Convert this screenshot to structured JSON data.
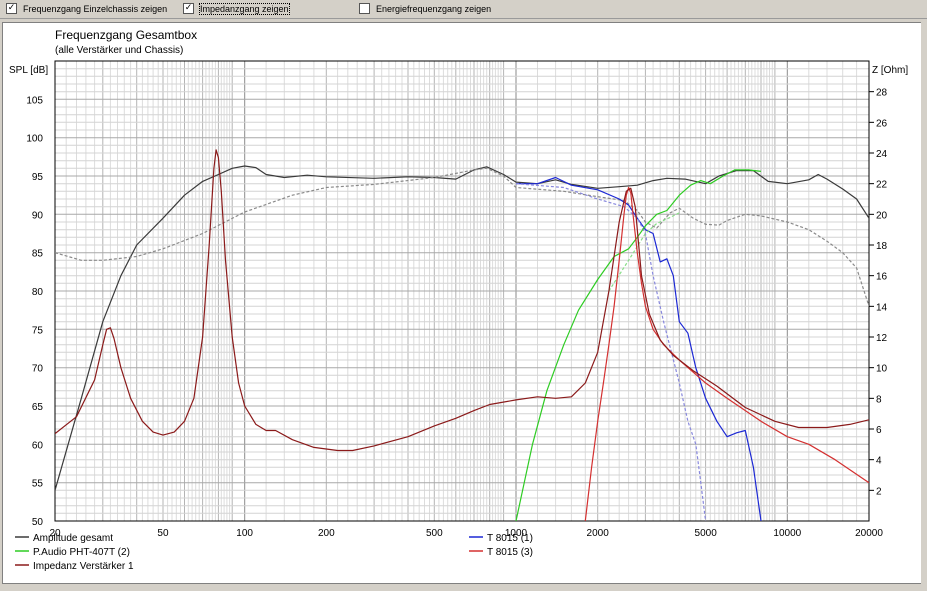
{
  "toolbar": {
    "options": [
      {
        "label": "Frequenzgang Einzelchassis zeigen",
        "checked": true,
        "check_glyph": "✓"
      },
      {
        "label": "Impedanzgang zeigen",
        "checked": true,
        "check_glyph": "✓"
      },
      {
        "label": "Energiefrequenzgang zeigen",
        "checked": false,
        "check_glyph": ""
      }
    ]
  },
  "chart_data": {
    "type": "line",
    "title": "Frequenzgang Gesamtbox",
    "subtitle": "(alle Verstärker und Chassis)",
    "xlabel": "",
    "ylabel": "SPL [dB]",
    "y2label": "Z [Ohm]",
    "xscale": "log",
    "xlim": [
      20,
      20000
    ],
    "ylim": [
      50,
      110
    ],
    "y2lim": [
      0,
      30
    ],
    "grid": true,
    "legend_position": "bottom",
    "x_ticks": [
      {
        "value": 20,
        "label": "20"
      },
      {
        "value": 50,
        "label": "50"
      },
      {
        "value": 100,
        "label": "100"
      },
      {
        "value": 200,
        "label": "200"
      },
      {
        "value": 500,
        "label": "500"
      },
      {
        "value": 1000,
        "label": "1000"
      },
      {
        "value": 2000,
        "label": "2000"
      },
      {
        "value": 5000,
        "label": "5000"
      },
      {
        "value": 10000,
        "label": "10000"
      },
      {
        "value": 20000,
        "label": "20000"
      }
    ],
    "y_ticks": [
      50,
      55,
      60,
      65,
      70,
      75,
      80,
      85,
      90,
      95,
      100,
      105
    ],
    "y2_ticks": [
      2,
      4,
      6,
      8,
      10,
      12,
      14,
      16,
      18,
      20,
      22,
      24,
      26,
      28
    ],
    "series": [
      {
        "name": "Amplitude gesamt",
        "color": "#3a3a3a",
        "axis": "left",
        "dash": false,
        "points": [
          [
            20,
            54
          ],
          [
            25,
            66
          ],
          [
            30,
            76
          ],
          [
            35,
            82
          ],
          [
            40,
            86
          ],
          [
            50,
            89.5
          ],
          [
            60,
            92.5
          ],
          [
            70,
            94.3
          ],
          [
            80,
            95.2
          ],
          [
            90,
            96
          ],
          [
            100,
            96.3
          ],
          [
            110,
            96.1
          ],
          [
            120,
            95.2
          ],
          [
            140,
            94.8
          ],
          [
            170,
            95.1
          ],
          [
            200,
            94.9
          ],
          [
            300,
            94.7
          ],
          [
            400,
            94.9
          ],
          [
            500,
            94.8
          ],
          [
            600,
            94.6
          ],
          [
            700,
            95.8
          ],
          [
            780,
            96.2
          ],
          [
            900,
            95.2
          ],
          [
            1000,
            94.2
          ],
          [
            1200,
            94
          ],
          [
            1400,
            94.5
          ],
          [
            1600,
            93.9
          ],
          [
            2000,
            93.4
          ],
          [
            2400,
            93.6
          ],
          [
            2800,
            93.8
          ],
          [
            3200,
            94.4
          ],
          [
            3600,
            94.7
          ],
          [
            4200,
            94.6
          ],
          [
            5000,
            94
          ],
          [
            5600,
            95
          ],
          [
            6500,
            95.7
          ],
          [
            7500,
            95.7
          ],
          [
            8500,
            94.3
          ],
          [
            10000,
            94
          ],
          [
            12000,
            94.5
          ],
          [
            13000,
            95.2
          ],
          [
            14000,
            94.6
          ],
          [
            16000,
            93.3
          ],
          [
            18000,
            92
          ],
          [
            20000,
            89.5
          ]
        ]
      },
      {
        "name": "Amplitude gesamt (gestrichelt)",
        "color": "#8a8a8a",
        "axis": "left",
        "dash": true,
        "points": [
          [
            20,
            85
          ],
          [
            25,
            84
          ],
          [
            30,
            84
          ],
          [
            40,
            84.5
          ],
          [
            50,
            85.5
          ],
          [
            70,
            87.5
          ],
          [
            100,
            90.3
          ],
          [
            150,
            92.5
          ],
          [
            200,
            93.5
          ],
          [
            300,
            93.9
          ],
          [
            500,
            94.8
          ],
          [
            700,
            95.8
          ],
          [
            780,
            96
          ],
          [
            900,
            95
          ],
          [
            1000,
            93.5
          ],
          [
            1500,
            93
          ],
          [
            2000,
            92.3
          ],
          [
            2500,
            91.8
          ],
          [
            2800,
            90.5
          ],
          [
            3000,
            89
          ],
          [
            3300,
            88.2
          ],
          [
            3700,
            90.2
          ],
          [
            4000,
            90.8
          ],
          [
            4500,
            89.5
          ],
          [
            5000,
            88.7
          ],
          [
            5600,
            88.6
          ],
          [
            6000,
            89.2
          ],
          [
            7000,
            90
          ],
          [
            8000,
            89.8
          ],
          [
            10000,
            89
          ],
          [
            12000,
            88
          ],
          [
            14000,
            86.5
          ],
          [
            16000,
            85
          ],
          [
            18000,
            83
          ],
          [
            20000,
            78
          ]
        ]
      },
      {
        "name": "T 8015 (1)",
        "color": "#1c28d4",
        "axis": "left",
        "dash": false,
        "points": [
          [
            1000,
            94
          ],
          [
            1200,
            94
          ],
          [
            1400,
            94.8
          ],
          [
            1600,
            93.8
          ],
          [
            2000,
            93.2
          ],
          [
            2400,
            92
          ],
          [
            2600,
            91.2
          ],
          [
            2800,
            89.5
          ],
          [
            3000,
            88
          ],
          [
            3200,
            87.5
          ],
          [
            3400,
            83.8
          ],
          [
            3600,
            84.2
          ],
          [
            3800,
            82
          ],
          [
            4000,
            76
          ],
          [
            4300,
            74.5
          ],
          [
            4600,
            70
          ],
          [
            5000,
            66
          ],
          [
            5500,
            63
          ],
          [
            6000,
            61
          ],
          [
            6500,
            61.5
          ],
          [
            7000,
            61.8
          ],
          [
            7500,
            57
          ],
          [
            8000,
            50
          ]
        ]
      },
      {
        "name": "T 8015 (1) (gestrichelt)",
        "color": "#8888dd",
        "axis": "left",
        "dash": true,
        "points": [
          [
            1000,
            94
          ],
          [
            1500,
            93.5
          ],
          [
            2000,
            92
          ],
          [
            2500,
            91
          ],
          [
            2800,
            89.5
          ],
          [
            3000,
            87.5
          ],
          [
            3200,
            82
          ],
          [
            3500,
            76
          ],
          [
            4000,
            68
          ],
          [
            4300,
            63
          ],
          [
            4600,
            60
          ],
          [
            4800,
            55
          ],
          [
            5000,
            50
          ]
        ]
      },
      {
        "name": "P.Audio PHT-407T (2)",
        "color": "#2ecc23",
        "axis": "left",
        "dash": false,
        "points": [
          [
            1000,
            50
          ],
          [
            1150,
            60
          ],
          [
            1300,
            67
          ],
          [
            1500,
            73
          ],
          [
            1700,
            77.5
          ],
          [
            2000,
            81.5
          ],
          [
            2300,
            84.5
          ],
          [
            2600,
            85.5
          ],
          [
            2800,
            87
          ],
          [
            3000,
            88.5
          ],
          [
            3300,
            90
          ],
          [
            3600,
            90.5
          ],
          [
            4000,
            92.5
          ],
          [
            4400,
            93.8
          ],
          [
            4800,
            94.4
          ],
          [
            5200,
            94
          ],
          [
            5800,
            95
          ],
          [
            6400,
            95.8
          ],
          [
            7200,
            95.8
          ],
          [
            8000,
            95.6
          ]
        ]
      },
      {
        "name": "P.Audio PHT-407T (2) (gestrichelt)",
        "color": "#88dd88",
        "axis": "left",
        "dash": true,
        "points": [
          [
            2200,
            80
          ],
          [
            2600,
            84
          ],
          [
            3000,
            87.5
          ],
          [
            3300,
            88.8
          ],
          [
            3700,
            89.6
          ],
          [
            4000,
            90.2
          ]
        ]
      },
      {
        "name": "T 8015 (3)",
        "color": "#d43030",
        "axis": "left",
        "dash": false,
        "points": [
          [
            1800,
            50
          ],
          [
            1900,
            57
          ],
          [
            2000,
            63
          ],
          [
            2100,
            68
          ],
          [
            2200,
            73
          ],
          [
            2300,
            78
          ],
          [
            2400,
            84
          ],
          [
            2500,
            90
          ],
          [
            2550,
            92.5
          ],
          [
            2600,
            93.5
          ],
          [
            2650,
            92.8
          ],
          [
            2700,
            90
          ],
          [
            2800,
            85
          ],
          [
            2900,
            81
          ],
          [
            3000,
            78
          ],
          [
            3200,
            75
          ],
          [
            3500,
            73
          ],
          [
            4000,
            71
          ],
          [
            5000,
            68
          ],
          [
            6000,
            66
          ],
          [
            8000,
            63
          ],
          [
            10000,
            61
          ],
          [
            12000,
            60
          ],
          [
            15000,
            58
          ],
          [
            20000,
            55
          ]
        ]
      },
      {
        "name": "Impedanz Verstärker 1",
        "color": "#8b1a1a",
        "axis": "right",
        "dash": false,
        "points": [
          [
            20,
            5.7
          ],
          [
            24,
            6.8
          ],
          [
            28,
            9.2
          ],
          [
            30,
            11.5
          ],
          [
            31,
            12.5
          ],
          [
            32,
            12.6
          ],
          [
            33,
            11.9
          ],
          [
            35,
            10
          ],
          [
            38,
            8
          ],
          [
            42,
            6.5
          ],
          [
            46,
            5.8
          ],
          [
            50,
            5.6
          ],
          [
            55,
            5.8
          ],
          [
            60,
            6.5
          ],
          [
            65,
            8
          ],
          [
            70,
            12
          ],
          [
            74,
            18
          ],
          [
            77,
            23
          ],
          [
            78.5,
            24.2
          ],
          [
            80,
            23.7
          ],
          [
            82,
            21.5
          ],
          [
            85,
            17
          ],
          [
            90,
            12
          ],
          [
            95,
            9
          ],
          [
            100,
            7.5
          ],
          [
            110,
            6.3
          ],
          [
            120,
            5.9
          ],
          [
            130,
            5.9
          ],
          [
            150,
            5.3
          ],
          [
            180,
            4.8
          ],
          [
            220,
            4.6
          ],
          [
            250,
            4.6
          ],
          [
            300,
            4.9
          ],
          [
            400,
            5.5
          ],
          [
            500,
            6.2
          ],
          [
            600,
            6.7
          ],
          [
            700,
            7.2
          ],
          [
            800,
            7.6
          ],
          [
            1000,
            7.9
          ],
          [
            1200,
            8.1
          ],
          [
            1400,
            8
          ],
          [
            1600,
            8.1
          ],
          [
            1800,
            9
          ],
          [
            2000,
            11
          ],
          [
            2200,
            15
          ],
          [
            2400,
            19.5
          ],
          [
            2550,
            21.5
          ],
          [
            2650,
            21.7
          ],
          [
            2750,
            20.5
          ],
          [
            2900,
            16
          ],
          [
            3100,
            13.5
          ],
          [
            3400,
            11.8
          ],
          [
            3800,
            10.8
          ],
          [
            4500,
            9.8
          ],
          [
            5500,
            8.8
          ],
          [
            7000,
            7.4
          ],
          [
            9000,
            6.5
          ],
          [
            11000,
            6.1
          ],
          [
            14000,
            6.1
          ],
          [
            17000,
            6.3
          ],
          [
            20000,
            6.6
          ]
        ]
      }
    ],
    "legend": [
      {
        "label": "Amplitude gesamt",
        "color": "#3a3a3a"
      },
      {
        "label": "T 8015 (1)",
        "color": "#1c28d4"
      },
      {
        "label": "P.Audio PHT-407T (2)",
        "color": "#2ecc23"
      },
      {
        "label": "T 8015 (3)",
        "color": "#d43030"
      },
      {
        "label": "Impedanz Verstärker 1",
        "color": "#8b1a1a"
      }
    ]
  }
}
